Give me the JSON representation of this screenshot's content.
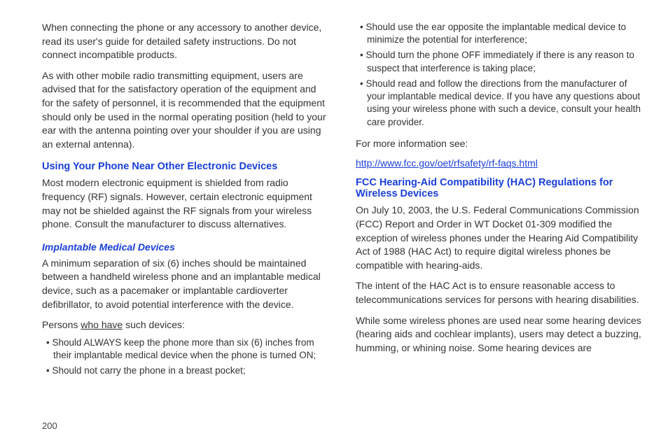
{
  "left": {
    "para1": "When connecting the phone or any accessory to another device, read its user's guide for detailed safety instructions. Do not connect incompatible products.",
    "para2": "As with other mobile radio transmitting equipment, users are advised that for the satisfactory operation of the equipment and for the safety of personnel, it is recommended that the equipment should only be used in the normal operating position (held to your ear with the antenna pointing over your shoulder if you are using an external antenna).",
    "heading1": "Using Your Phone Near Other Electronic Devices",
    "para3": "Most modern electronic equipment is shielded from radio frequency (RF) signals. However, certain electronic equipment may not be shielded against the RF signals from your wireless phone. Consult the manufacturer to discuss alternatives.",
    "heading2": "Implantable Medical Devices",
    "para4": "A minimum separation of six (6) inches should be maintained between a handheld wireless phone and an implantable medical device, such as a pacemaker or implantable cardioverter defibrillator, to avoid potential interference with the device.",
    "intro_prefix": "Persons ",
    "intro_underline": "who have",
    "intro_suffix": " such devices:",
    "bullets": [
      "Should ALWAYS keep the phone more than six (6) inches from their implantable medical device when the phone is turned ON;",
      "Should not carry the phone in a breast pocket;"
    ]
  },
  "right": {
    "bullets": [
      "Should use the ear opposite the implantable medical device to minimize the potential for interference;",
      "Should turn the phone OFF immediately if there is any reason to suspect that interference is taking place;",
      "Should read and follow the directions from the manufacturer of your implantable medical device. If you have any questions about using your wireless phone with such a device, consult your health care provider."
    ],
    "para1": "For more information see:",
    "link": "http://www.fcc.gov/oet/rfsafety/rf-faqs.html",
    "heading1": "FCC Hearing-Aid Compatibility (HAC) Regulations for Wireless Devices",
    "para2": "On July 10, 2003, the U.S. Federal Communications Commission (FCC) Report and Order in WT Docket 01-309 modified the exception of wireless phones under the Hearing Aid Compatibility Act of 1988 (HAC Act) to require digital wireless phones be compatible with hearing-aids.",
    "para3": "The intent of the HAC Act is to ensure reasonable access to telecommunications services for persons with hearing disabilities.",
    "para4": "While some wireless phones are used near some hearing devices (hearing aids and cochlear implants), users may detect a buzzing, humming, or whining noise. Some hearing devices are"
  },
  "page_number": "200"
}
